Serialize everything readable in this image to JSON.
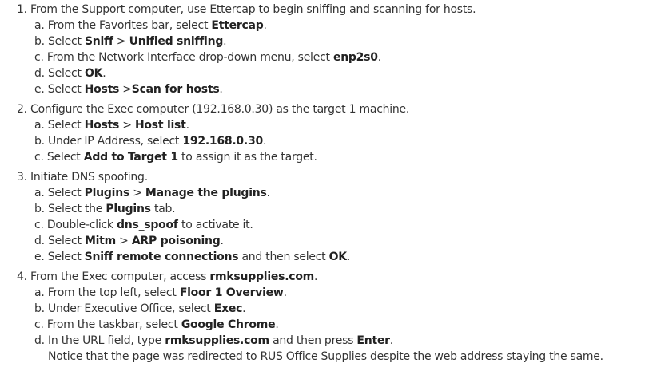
{
  "steps": [
    {
      "text": [
        "1. From the Support computer, use Ettercap to begin sniffing and scanning for hosts."
      ],
      "subs": [
        {
          "parts": [
            "a. From the Favorites bar, select ",
            "Ettercap",
            "."
          ]
        },
        {
          "parts": [
            "b. Select ",
            "Sniff",
            " > ",
            "Unified sniffing",
            "."
          ]
        },
        {
          "parts": [
            "c. From the Network Interface drop-down menu, select ",
            "enp2s0",
            "."
          ]
        },
        {
          "parts": [
            "d. Select ",
            "OK",
            "."
          ]
        },
        {
          "parts": [
            "e. Select ",
            "Hosts",
            " >",
            "Scan for hosts",
            "."
          ]
        }
      ]
    },
    {
      "text": [
        "2. Configure the Exec computer (192.168.0.30) as the target 1 machine."
      ],
      "subs": [
        {
          "parts": [
            "a. Select ",
            "Hosts",
            " > ",
            "Host list",
            "."
          ]
        },
        {
          "parts": [
            "b. Under IP Address, select ",
            "192.168.0.30",
            "."
          ]
        },
        {
          "parts": [
            "c. Select ",
            "Add to Target 1",
            " to assign it as the target."
          ]
        }
      ]
    },
    {
      "text": [
        "3. Initiate DNS spoofing."
      ],
      "subs": [
        {
          "parts": [
            "a. Select ",
            "Plugins",
            " > ",
            "Manage the plugins",
            "."
          ]
        },
        {
          "parts": [
            "b. Select the ",
            "Plugins",
            " tab."
          ]
        },
        {
          "parts": [
            "c. Double-click ",
            "dns_spoof",
            " to activate it."
          ]
        },
        {
          "parts": [
            "d. Select ",
            "Mitm",
            " > ",
            "ARP poisoning",
            "."
          ]
        },
        {
          "parts": [
            "e. Select ",
            "Sniff remote connections",
            " and then select ",
            "OK",
            "."
          ]
        }
      ]
    },
    {
      "text": [
        "4. From the Exec computer, access ",
        "rmksupplies.com",
        "."
      ],
      "subs": [
        {
          "parts": [
            "a. From the top left, select ",
            "Floor 1 Overview",
            "."
          ]
        },
        {
          "parts": [
            "b. Under Executive Office, select ",
            "Exec",
            "."
          ]
        },
        {
          "parts": [
            "c. From the taskbar, select ",
            "Google Chrome",
            "."
          ]
        },
        {
          "parts": [
            "d. In the URL field, type ",
            "rmksupplies.com",
            " and then press ",
            "Enter",
            "."
          ]
        }
      ],
      "note": "Notice that the page was redirected to RUS Office Supplies despite the web address staying the same."
    }
  ]
}
